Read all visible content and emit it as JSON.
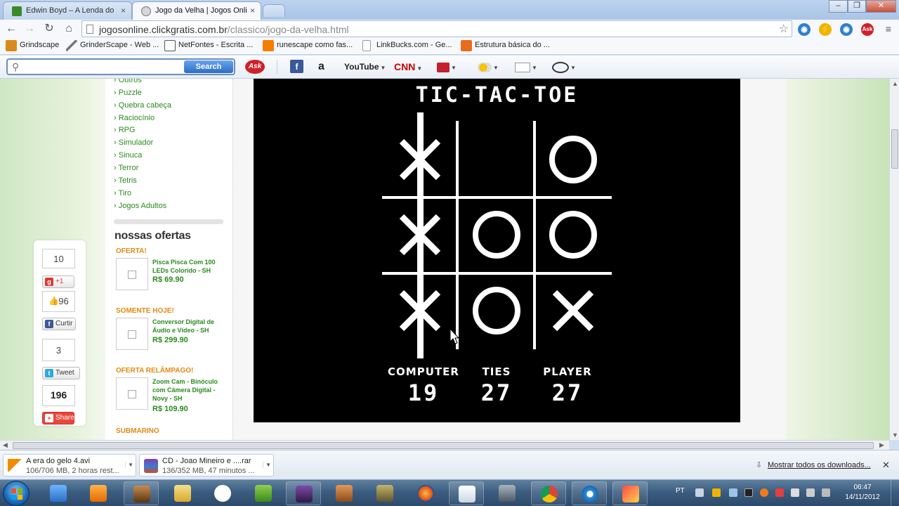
{
  "browser": {
    "tabs": [
      {
        "title": "Edwin Boyd – A Lenda do",
        "active": false
      },
      {
        "title": "Jogo da Velha | Jogos Onli",
        "active": true
      }
    ],
    "url": {
      "host": "jogosonline.clickgratis.com.br",
      "path": "/classico/jogo-da-velha.html"
    },
    "bookmarks": [
      {
        "label": "Grindscape",
        "icon": "grindscape-icon"
      },
      {
        "label": "GrinderScape - Web ...",
        "icon": "sword-icon"
      },
      {
        "label": "NetFontes - Escrita ...",
        "icon": "netfontes-icon"
      },
      {
        "label": "runescape como fas...",
        "icon": "blogger-icon"
      },
      {
        "label": "LinkBucks.com - Ge...",
        "icon": "page-icon"
      },
      {
        "label": "Estrutura básica do ...",
        "icon": "estrutura-icon"
      }
    ]
  },
  "ask_toolbar": {
    "search_placeholder": "",
    "search_button": "Search",
    "ask_logo": "Ask",
    "youtube": "YouTube",
    "cnn": "CNN"
  },
  "sidebar": {
    "categories": [
      "Outros",
      "Puzzle",
      "Quebra cabeça",
      "Raciocínio",
      "RPG",
      "Simulador",
      "Sinuca",
      "Terror",
      "Tetris",
      "Tiro",
      "Jogos Adultos"
    ],
    "offers_title": "nossas ofertas",
    "offers": [
      {
        "tag": "OFERTA!",
        "name": "Pisca Pisca Com 100 LEDs Colorido - SH",
        "price": "R$ 69.90"
      },
      {
        "tag": "SOMENTE HOJE!",
        "name": "Conversor Digital de Áudio e Vídeo - SH",
        "price": "R$ 299.90"
      },
      {
        "tag": "OFERTA RELÂMPAGO!",
        "name": "Zoom Cam - Binóculo com Câmera Digital - Novy - SH",
        "price": "R$ 109.90"
      }
    ],
    "next_tag": "SUBMARINO"
  },
  "social": {
    "gplus_count": "10",
    "gplus_label": "+1",
    "like_count": "96",
    "fb_label": "Curtir",
    "tweet_count": "3",
    "tweet_label": "Tweet",
    "share_count": "196",
    "share_label": "Share"
  },
  "game": {
    "title": "TIC-TAC-TOE",
    "board": [
      [
        "X",
        "",
        "O"
      ],
      [
        "X",
        "O",
        "O"
      ],
      [
        "X",
        "O",
        "X"
      ]
    ],
    "scores": [
      {
        "label": "COMPUTER",
        "value": "19"
      },
      {
        "label": "TIES",
        "value": "27"
      },
      {
        "label": "PLAYER",
        "value": "27"
      }
    ]
  },
  "downloads": {
    "items": [
      {
        "name": "A era do gelo 4.avi",
        "status": "106/706 MB, 2 horas rest..."
      },
      {
        "name": "CD - Joao Mineiro e ....rar",
        "status": "136/352 MB, 47 minutos ..."
      }
    ],
    "show_all": "Mostrar todos os downloads..."
  },
  "taskbar": {
    "lang": "PT",
    "time": "06:47",
    "date": "14/11/2012"
  },
  "colors": {
    "link_green": "#2a8a1e",
    "offer_orange": "#e38a12",
    "game_bg": "#000000",
    "game_fg": "#ffffff"
  }
}
